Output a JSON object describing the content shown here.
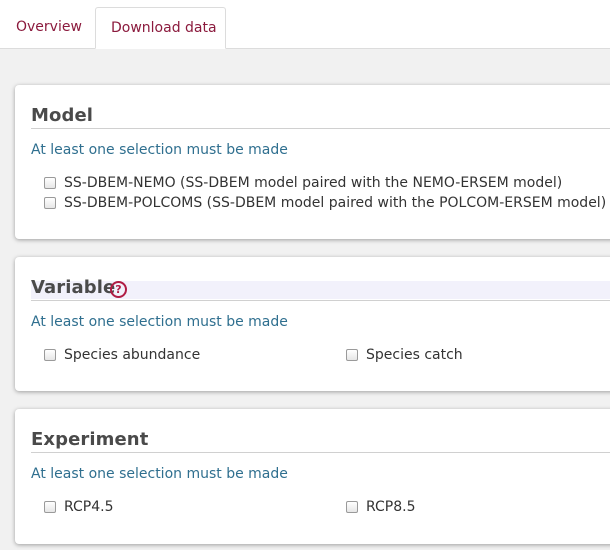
{
  "tabs": [
    {
      "label": "Overview",
      "active": false
    },
    {
      "label": "Download data",
      "active": true
    }
  ],
  "sections": {
    "model": {
      "title": "Model",
      "hint": "At least one selection must be made",
      "options": [
        {
          "label": "SS-DBEM-NEMO (SS-DBEM model paired with the NEMO-ERSEM model)",
          "checked": false
        },
        {
          "label": "SS-DBEM-POLCOMS (SS-DBEM model paired with the POLCOM-ERSEM model)",
          "checked": false
        }
      ]
    },
    "variable": {
      "title": "Variable",
      "help_icon": "question-circle-icon",
      "hint": "At least one selection must be made",
      "options": [
        {
          "label": "Species abundance",
          "checked": false
        },
        {
          "label": "Species catch",
          "checked": false
        }
      ]
    },
    "experiment": {
      "title": "Experiment",
      "hint": "At least one selection must be made",
      "options": [
        {
          "label": "RCP4.5",
          "checked": false
        },
        {
          "label": "RCP8.5",
          "checked": false
        }
      ]
    }
  },
  "colors": {
    "tab_text": "#8b1a3d",
    "hint_text": "#2f6f8f",
    "help_icon": "#b01c44"
  }
}
